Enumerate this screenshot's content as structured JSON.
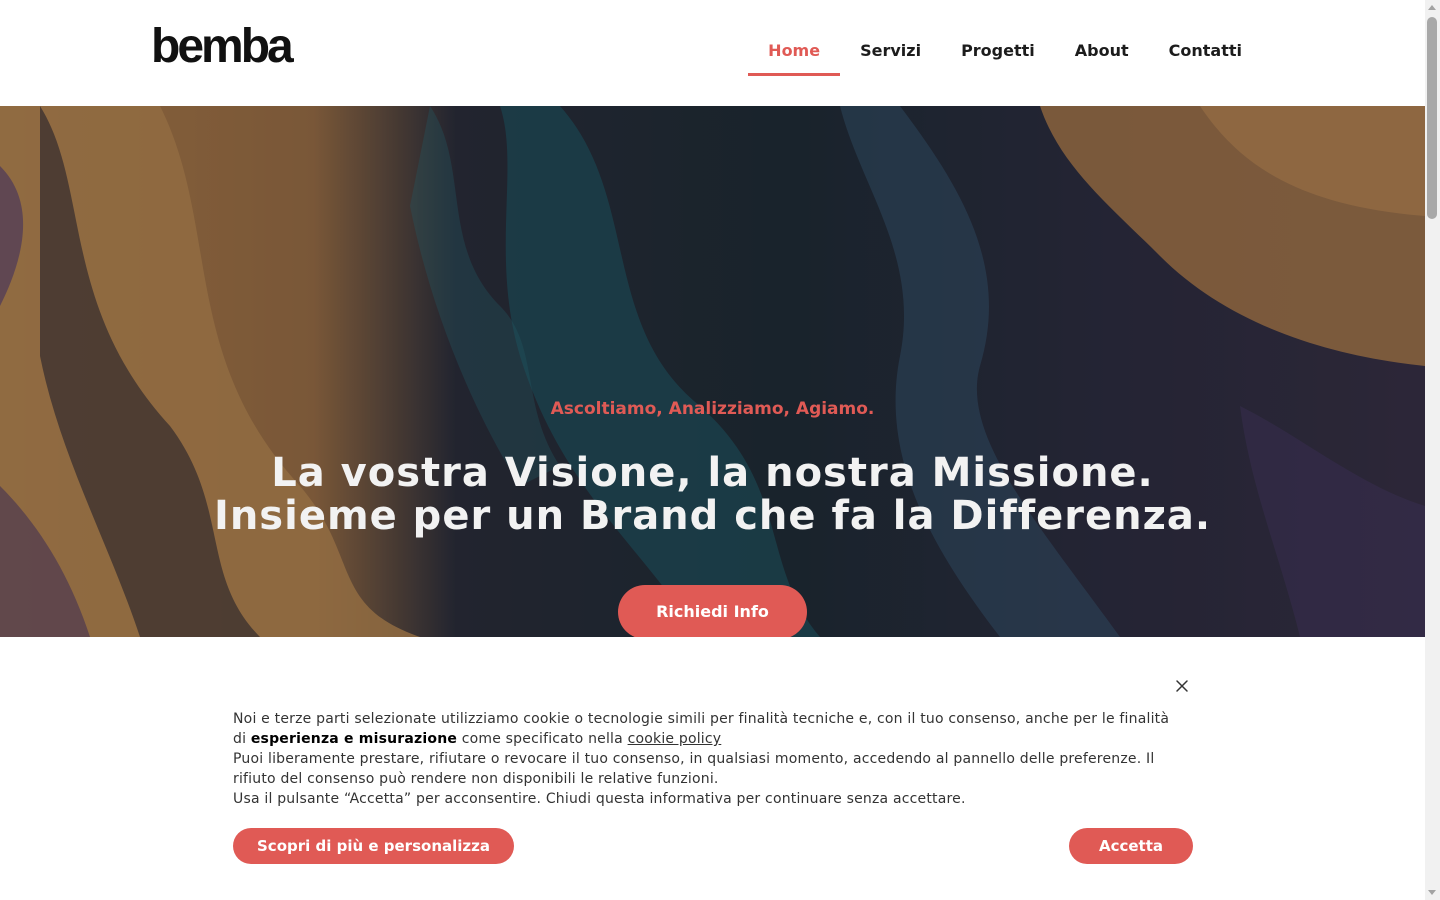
{
  "header": {
    "logo": "bemba",
    "nav": [
      {
        "label": "Home",
        "active": true
      },
      {
        "label": "Servizi",
        "active": false
      },
      {
        "label": "Progetti",
        "active": false
      },
      {
        "label": "About",
        "active": false
      },
      {
        "label": "Contatti",
        "active": false
      }
    ]
  },
  "hero": {
    "tagline": "Ascoltiamo, Analizziamo, Agiamo.",
    "title_line1": "La vostra Visione, la nostra Missione.",
    "title_line2": "Insieme per un Brand che fa la Differenza.",
    "button_label": "Richiedi Info"
  },
  "cookie_banner": {
    "line1_a": "Noi e terze parti selezionate utilizziamo cookie o tecnologie simili per finalità tecniche e, con il tuo consenso, anche per le finalità di",
    "line1_bold": "esperienza e misurazione",
    "line1_b": "come specificato nella",
    "cookie_policy_link": "cookie policy",
    "line2": "Puoi liberamente prestare, rifiutare o revocare il tuo consenso, in qualsiasi momento, accedendo al pannello delle preferenze. Il rifiuto del consenso può rendere non disponibili le relative funzioni.",
    "line3": "Usa il pulsante “Accetta” per acconsentire. Chiudi questa informativa per continuare senza accettare.",
    "more_button": "Scopri di più e personalizza",
    "accept_button": "Accetta"
  },
  "colors": {
    "accent": "#e05a55",
    "text_dark": "#1c1c1c",
    "hero_text": "#f2f2f2"
  }
}
